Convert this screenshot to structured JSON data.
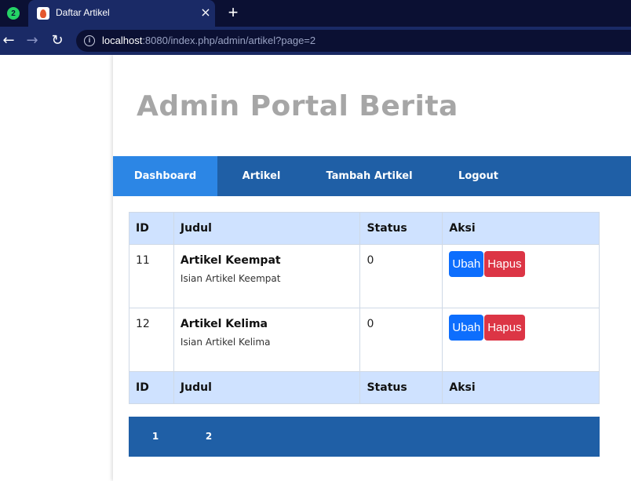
{
  "browser": {
    "pinned_tab_badge": "2",
    "tab_title": "Daftar Artikel",
    "tab_close": "×",
    "new_tab": "+",
    "url_host": "localhost",
    "url_rest": ":8080/index.php/admin/artikel?page=2"
  },
  "site": {
    "title": "Admin Portal Berita"
  },
  "nav": {
    "items": [
      {
        "label": "Dashboard"
      },
      {
        "label": "Artikel"
      },
      {
        "label": "Tambah Artikel"
      },
      {
        "label": "Logout"
      }
    ]
  },
  "table": {
    "headers": [
      "ID",
      "Judul",
      "Status",
      "Aksi"
    ],
    "rows": [
      {
        "id": "11",
        "title": "Artikel Keempat",
        "body": "Isian Artikel Keempat",
        "status": "0",
        "edit": "Ubah",
        "delete": "Hapus"
      },
      {
        "id": "12",
        "title": "Artikel Kelima",
        "body": "Isian Artikel Kelima",
        "status": "0",
        "edit": "Ubah",
        "delete": "Hapus"
      }
    ]
  },
  "pagination": {
    "pages": [
      "1",
      "2"
    ]
  },
  "colors": {
    "nav_bg": "#1f5fa6",
    "nav_active": "#2c86e5",
    "table_header": "#cfe2ff",
    "edit_button": "#0d6efd",
    "delete_button": "#dc3545"
  }
}
